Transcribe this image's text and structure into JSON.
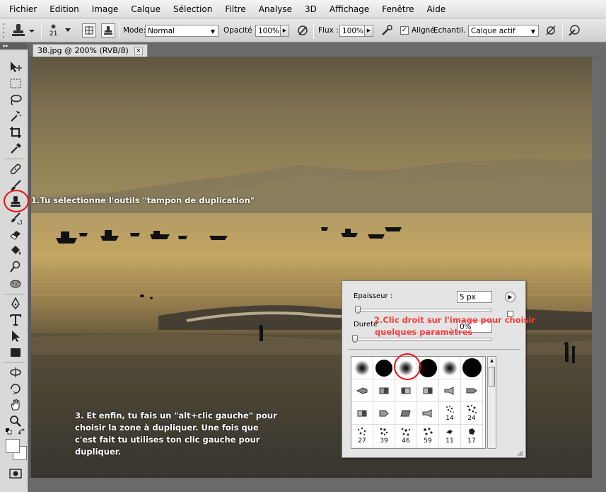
{
  "menubar": {
    "items": [
      "Fichier",
      "Edition",
      "Image",
      "Calque",
      "Sélection",
      "Filtre",
      "Analyse",
      "3D",
      "Affichage",
      "Fenêtre",
      "Aide"
    ]
  },
  "options": {
    "brush_size": "21",
    "mode_label": "Mode:",
    "mode_value": "Normal",
    "opacity_label": "Opacité :",
    "opacity_value": "100%",
    "flow_label": "Flux :",
    "flow_value": "100%",
    "aligned_label": "Aligné",
    "aligned_checked": "✓",
    "sample_label": "Echantil. :",
    "sample_value": "Calque actif"
  },
  "toolbar": {
    "collapse": "▸▸"
  },
  "document": {
    "tab_title": "38.jpg @ 200% (RVB/8)",
    "close": "×"
  },
  "annotations": {
    "step1": "1.Tu sélectionne l'outils \"tampon de duplication\"",
    "step2_line1": "2.Clic droit sur l'image pour choisir",
    "step2_line2": "quelques paramètres",
    "step3_line1": "3. Et enfin, tu fais un \"alt+clic gauche\" pour",
    "step3_line2": "choisir la zone à dupliquer. Une fois que",
    "step3_line3": "c'est fait tu utilises ton clic gauche pour",
    "step3_line4": "dupliquer."
  },
  "brush_panel": {
    "size_label": "Epaisseur :",
    "size_value": "5 px",
    "hardness_label": "Dureté",
    "hardness_value": "0%",
    "brush_numbers": [
      "14",
      "24",
      "27",
      "39",
      "46",
      "59",
      "11",
      "17"
    ]
  },
  "colors": {
    "highlight": "#e11111",
    "annotation_red": "#ff3a3a"
  }
}
